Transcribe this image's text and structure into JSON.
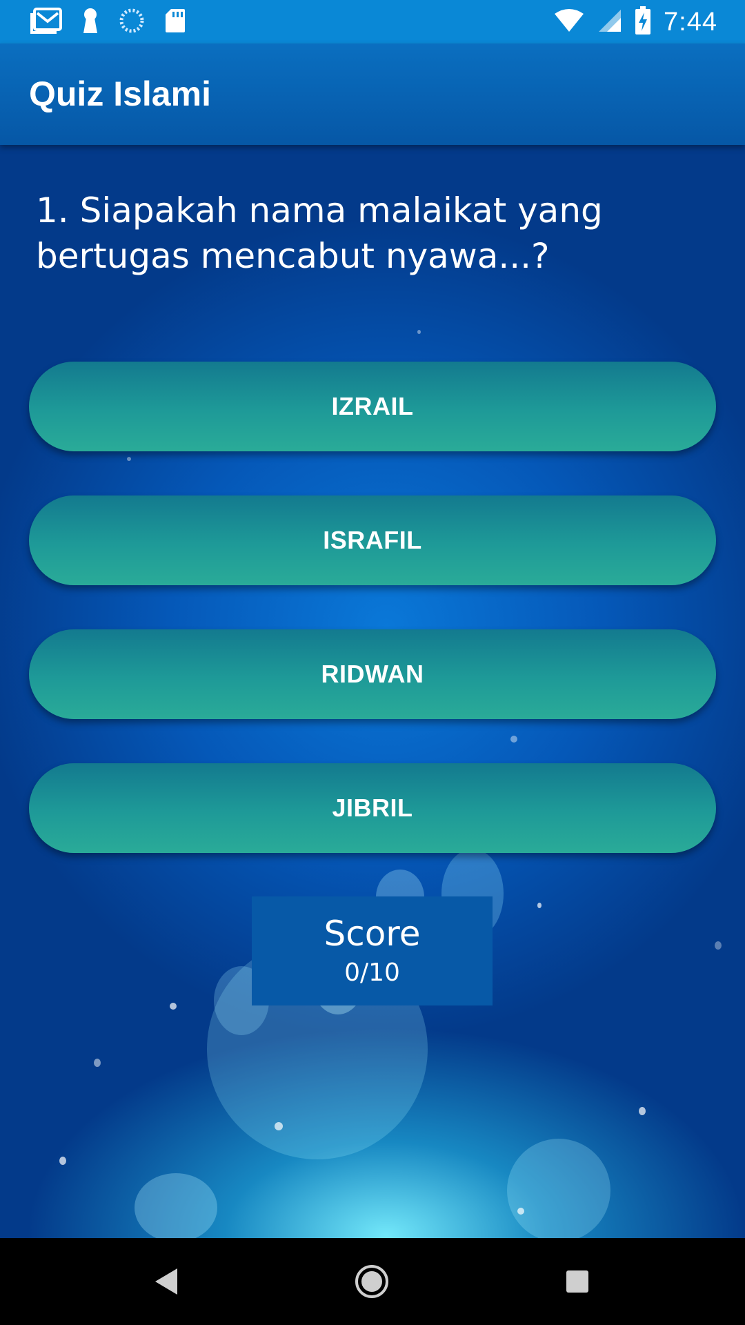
{
  "status_bar": {
    "time": "7:44",
    "icons_left": [
      "gmail-icon",
      "keyhole-icon",
      "sync-icon",
      "sd-card-icon"
    ],
    "icons_right": [
      "wifi-icon",
      "signal-icon",
      "battery-charging-icon"
    ]
  },
  "app_bar": {
    "title": "Quiz Islami"
  },
  "quiz": {
    "question": "1. Siapakah nama malaikat yang bertugas mencabut nyawa...?",
    "answers": [
      {
        "label": "IZRAIL"
      },
      {
        "label": "ISRAFIL"
      },
      {
        "label": "RIDWAN"
      },
      {
        "label": "JIBRIL"
      }
    ],
    "score": {
      "title": "Score",
      "value": "0/10"
    }
  },
  "nav_bar": {
    "buttons": [
      "back-icon",
      "home-icon",
      "recents-icon"
    ]
  },
  "colors": {
    "status_bar": "#0a88d6",
    "app_bar": "#0a6fc0",
    "answer_button": "#1e9a98",
    "score_box": "#0759a7"
  }
}
